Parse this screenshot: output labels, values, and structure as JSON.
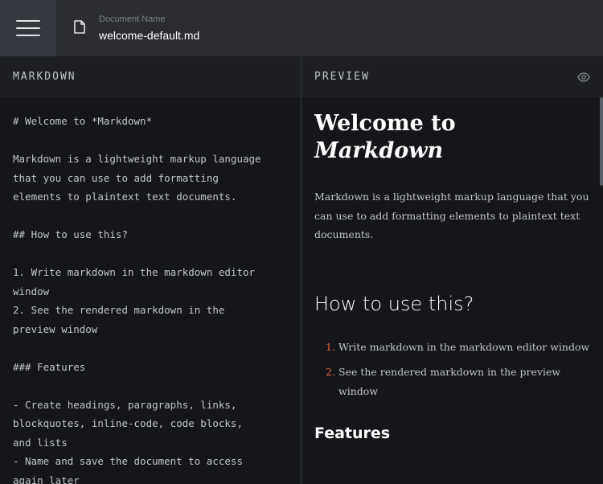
{
  "topbar": {
    "doc_label": "Document Name",
    "doc_name": "welcome-default.md"
  },
  "editor_pane": {
    "title": "MARKDOWN",
    "lines": [
      "# Welcome to *Markdown*",
      "",
      "Markdown is a lightweight markup language",
      "that you can use to add formatting",
      "elements to plaintext text documents.",
      "",
      "## How to use this?",
      "",
      "1. Write markdown in the markdown editor",
      "window",
      "2. See the rendered markdown in the",
      "preview window",
      "",
      "### Features",
      "",
      "- Create headings, paragraphs, links,",
      "blockquotes, inline-code, code blocks,",
      "and lists",
      "- Name and save the document to access",
      "again later"
    ]
  },
  "preview_pane": {
    "title": "PREVIEW",
    "h1_prefix": "Welcome to",
    "h1_emph": "Markdown",
    "paragraph": "Markdown is a lightweight markup language that you can use to add formatting elements to plaintext text documents.",
    "h2": "How to use this?",
    "list": [
      {
        "num": "1.",
        "text": "Write markdown in the markdown editor window"
      },
      {
        "num": "2.",
        "text": "See the rendered markdown in the preview window"
      }
    ],
    "h3": "Features"
  },
  "colors": {
    "accent": "#e46643",
    "topbar": "#2b2d31",
    "background": "#151619"
  },
  "icons": {
    "menu": "hamburger-icon",
    "document": "document-icon",
    "preview_toggle": "eye-icon"
  }
}
